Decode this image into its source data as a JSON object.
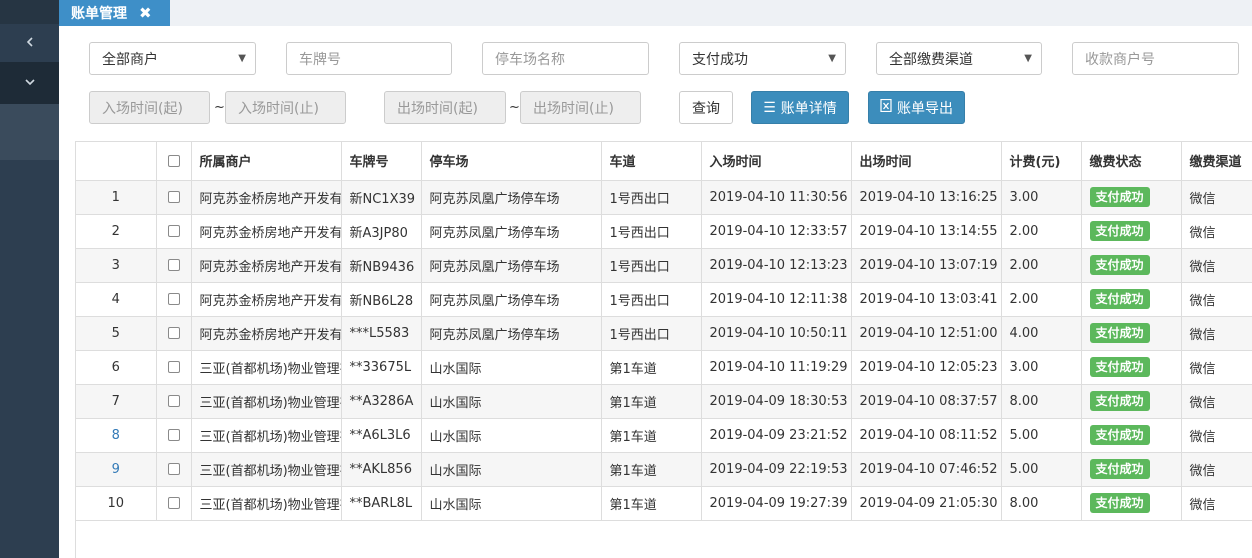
{
  "tab": {
    "title": "账单管理",
    "close_icon": "close-icon"
  },
  "sidebar": {
    "collapse_icon": "chevron-left-icon",
    "expand_icon": "chevron-down-icon"
  },
  "filters": {
    "merchant": "全部商户",
    "plate_placeholder": "车牌号",
    "lot_placeholder": "停车场名称",
    "pay_status": "支付成功",
    "channel": "全部缴费渠道",
    "payee_placeholder": "收款商户号",
    "entry_start_placeholder": "入场时间(起)",
    "entry_end_placeholder": "入场时间(止)",
    "exit_start_placeholder": "出场时间(起)",
    "exit_end_placeholder": "出场时间(止)",
    "range_sep": "~"
  },
  "buttons": {
    "query": "查询",
    "detail": "账单详情",
    "export": "账单导出"
  },
  "table": {
    "headers": [
      "",
      "",
      "所属商户",
      "车牌号",
      "停车场",
      "车道",
      "入场时间",
      "出场时间",
      "计费(元)",
      "缴费状态",
      "缴费渠道"
    ],
    "rows": [
      {
        "no": "1",
        "merchant": "阿克苏金桥房地产开发有限",
        "plate": "新NC1X39",
        "lot": "阿克苏凤凰广场停车场",
        "lane": "1号西出口",
        "entry": "2019-04-10 11:30:56",
        "exit": "2019-04-10 13:16:25",
        "fee": "3.00",
        "status": "支付成功",
        "channel": "微信"
      },
      {
        "no": "2",
        "merchant": "阿克苏金桥房地产开发有限",
        "plate": "新A3JP80",
        "lot": "阿克苏凤凰广场停车场",
        "lane": "1号西出口",
        "entry": "2019-04-10 12:33:57",
        "exit": "2019-04-10 13:14:55",
        "fee": "2.00",
        "status": "支付成功",
        "channel": "微信"
      },
      {
        "no": "3",
        "merchant": "阿克苏金桥房地产开发有限",
        "plate": "新NB9436",
        "lot": "阿克苏凤凰广场停车场",
        "lane": "1号西出口",
        "entry": "2019-04-10 12:13:23",
        "exit": "2019-04-10 13:07:19",
        "fee": "2.00",
        "status": "支付成功",
        "channel": "微信"
      },
      {
        "no": "4",
        "merchant": "阿克苏金桥房地产开发有限",
        "plate": "新NB6L28",
        "lot": "阿克苏凤凰广场停车场",
        "lane": "1号西出口",
        "entry": "2019-04-10 12:11:38",
        "exit": "2019-04-10 13:03:41",
        "fee": "2.00",
        "status": "支付成功",
        "channel": "微信"
      },
      {
        "no": "5",
        "merchant": "阿克苏金桥房地产开发有限",
        "plate": "***L5583",
        "lot": "阿克苏凤凰广场停车场",
        "lane": "1号西出口",
        "entry": "2019-04-10 10:50:11",
        "exit": "2019-04-10 12:51:00",
        "fee": "4.00",
        "status": "支付成功",
        "channel": "微信"
      },
      {
        "no": "6",
        "merchant": "三亚(首都机场)物业管理有",
        "plate": "**33675L",
        "lot": "山水国际",
        "lane": "第1车道",
        "entry": "2019-04-10 11:19:29",
        "exit": "2019-04-10 12:05:23",
        "fee": "3.00",
        "status": "支付成功",
        "channel": "微信"
      },
      {
        "no": "7",
        "merchant": "三亚(首都机场)物业管理有",
        "plate": "**A3286A",
        "lot": "山水国际",
        "lane": "第1车道",
        "entry": "2019-04-09 18:30:53",
        "exit": "2019-04-10 08:37:57",
        "fee": "8.00",
        "status": "支付成功",
        "channel": "微信"
      },
      {
        "no": "8",
        "merchant": "三亚(首都机场)物业管理有",
        "plate": "**A6L3L6",
        "lot": "山水国际",
        "lane": "第1车道",
        "entry": "2019-04-09 23:21:52",
        "exit": "2019-04-10 08:11:52",
        "fee": "5.00",
        "status": "支付成功",
        "channel": "微信"
      },
      {
        "no": "9",
        "merchant": "三亚(首都机场)物业管理有",
        "plate": "**AKL856",
        "lot": "山水国际",
        "lane": "第1车道",
        "entry": "2019-04-09 22:19:53",
        "exit": "2019-04-10 07:46:52",
        "fee": "5.00",
        "status": "支付成功",
        "channel": "微信"
      },
      {
        "no": "10",
        "merchant": "三亚(首都机场)物业管理有",
        "plate": "**BARL8L",
        "lot": "山水国际",
        "lane": "第1车道",
        "entry": "2019-04-09 19:27:39",
        "exit": "2019-04-09 21:05:30",
        "fee": "8.00",
        "status": "支付成功",
        "channel": "微信"
      }
    ]
  },
  "colors": {
    "primary": "#3c8dbc",
    "success": "#5cb85c",
    "sidebar": "#2d3e50"
  }
}
